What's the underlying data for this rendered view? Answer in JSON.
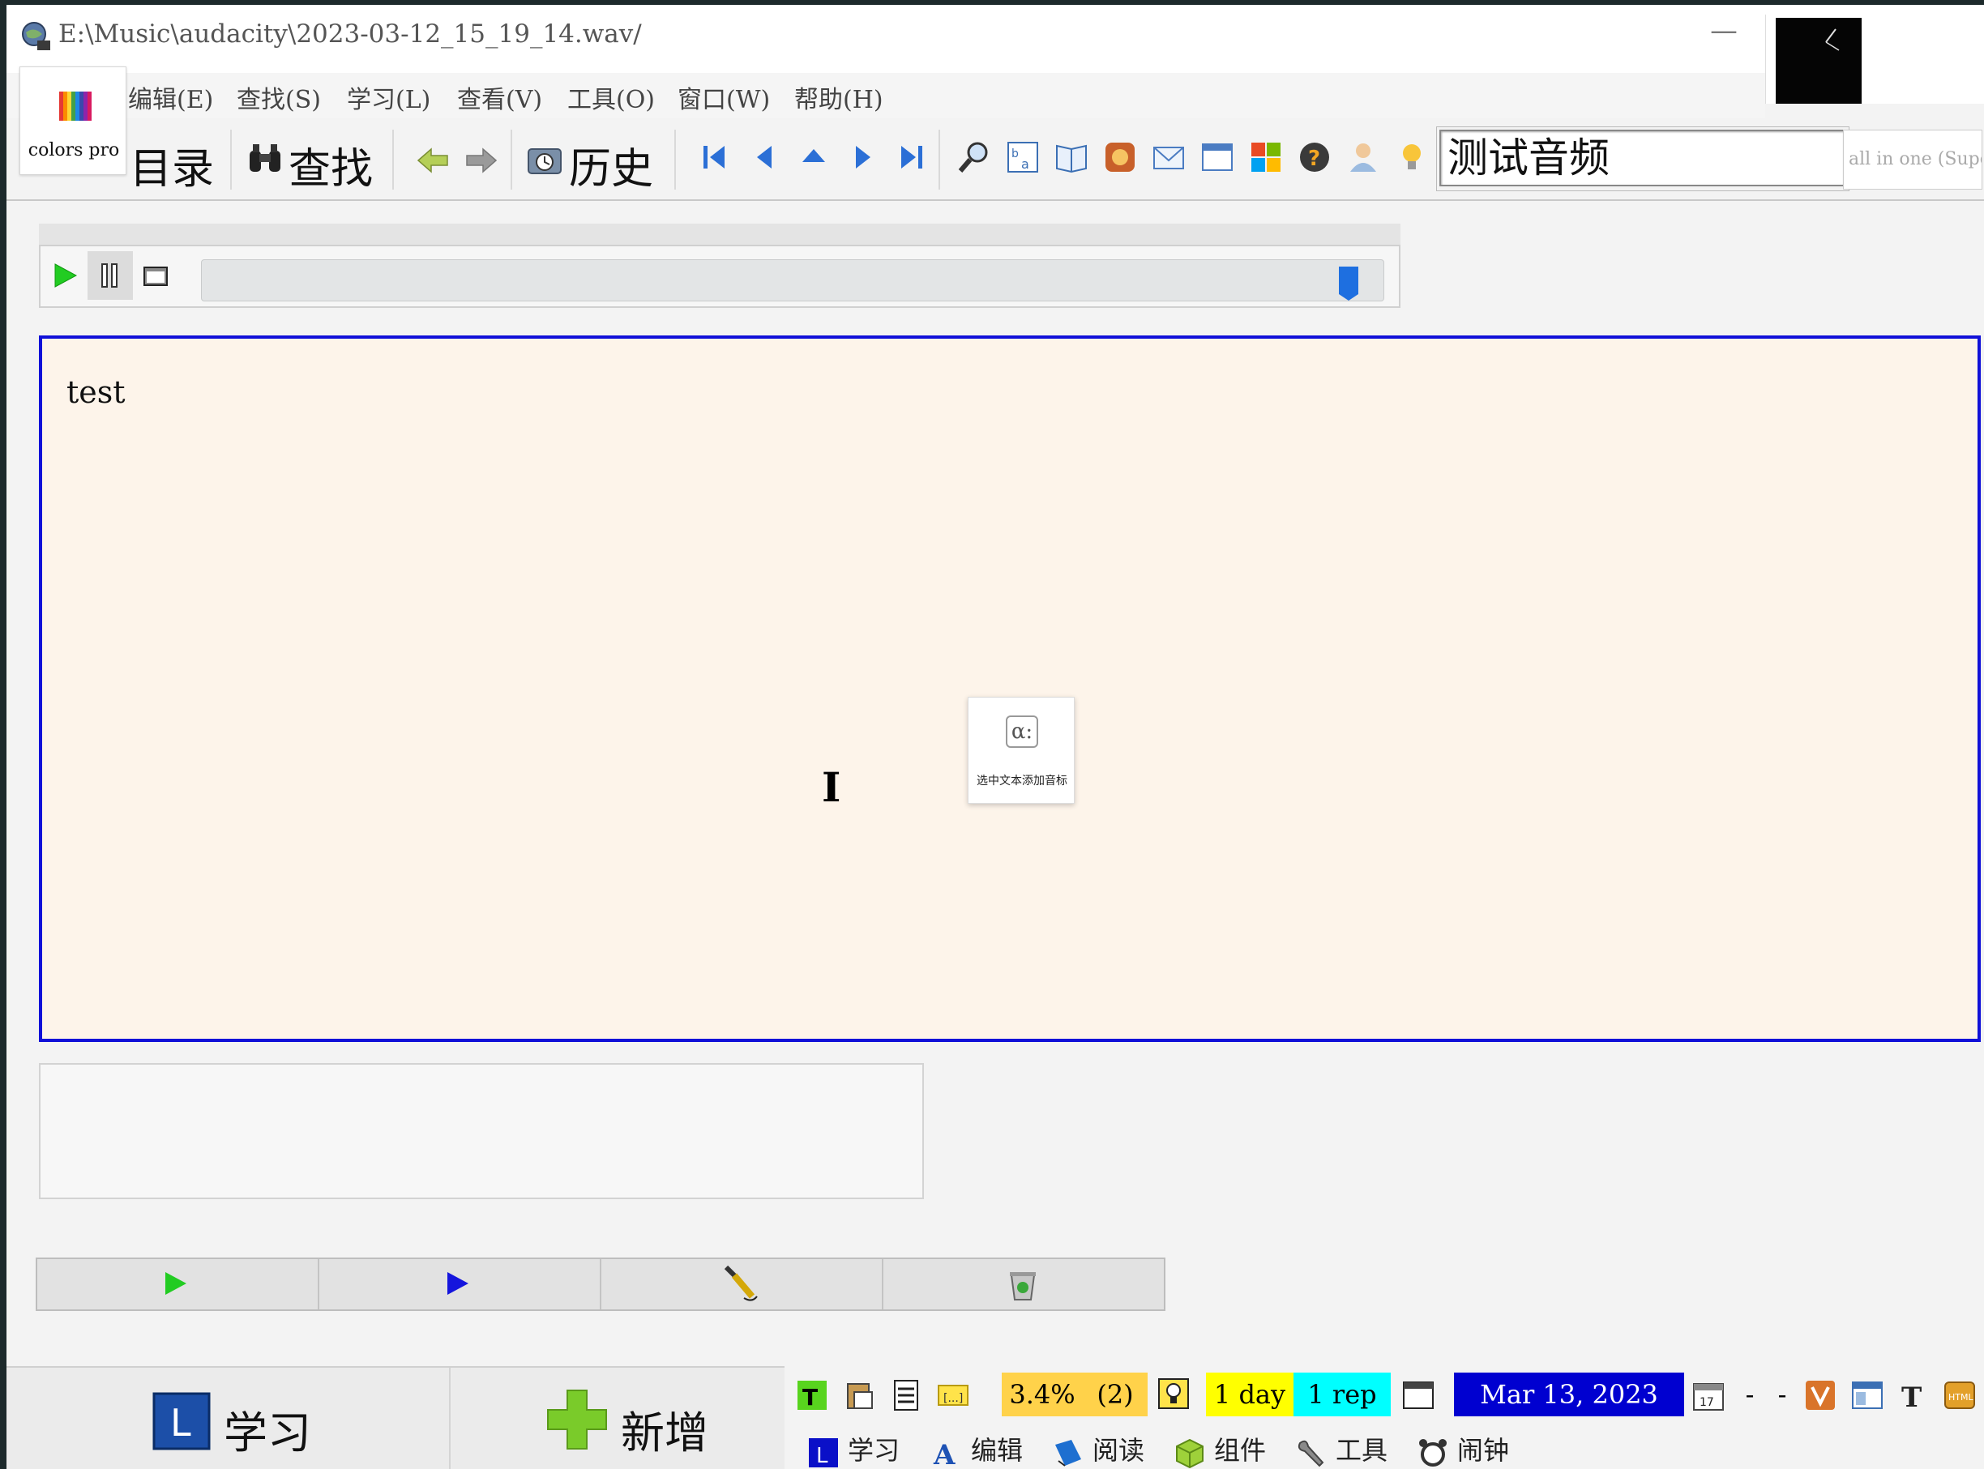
{
  "window": {
    "title": "E:\\Music\\audacity\\2023-03-12_15_19_14.wav/",
    "minimize_label": "—"
  },
  "menu": {
    "items": [
      "编辑(E)",
      "查找(S)",
      "学习(L)",
      "查看(V)",
      "工具(O)",
      "窗口(W)",
      "帮助(H)"
    ]
  },
  "colors_pro": {
    "label": "colors pro"
  },
  "toolbar": {
    "contents_label": "目录",
    "find_label": "查找",
    "history_label": "历史",
    "search_value": "测试音频",
    "reference_placeholder": "all in one (Supe"
  },
  "player": {
    "position_fraction": 0.98
  },
  "content": {
    "text": "test"
  },
  "popup": {
    "glyph": "α:",
    "caption": "选中文本添加音标"
  },
  "bottom": {
    "learn_label": "学习",
    "add_label": "新增"
  },
  "status": {
    "progress": "3.4%",
    "count": "(2)",
    "interval": "1 day",
    "reps": "1 rep",
    "date": "Mar 13, 2023",
    "dash1": "-",
    "dash2": "-"
  },
  "tabs": [
    "学习",
    "编辑",
    "阅读",
    "组件",
    "工具",
    "闹钟"
  ],
  "colors": {
    "accent_blue": "#1010d8",
    "content_bg": "#fdf4ea",
    "progress_bg": "#ffd24a",
    "interval_bg": "#ffff00",
    "reps_bg": "#00ffff",
    "date_bg": "#0000d0"
  }
}
